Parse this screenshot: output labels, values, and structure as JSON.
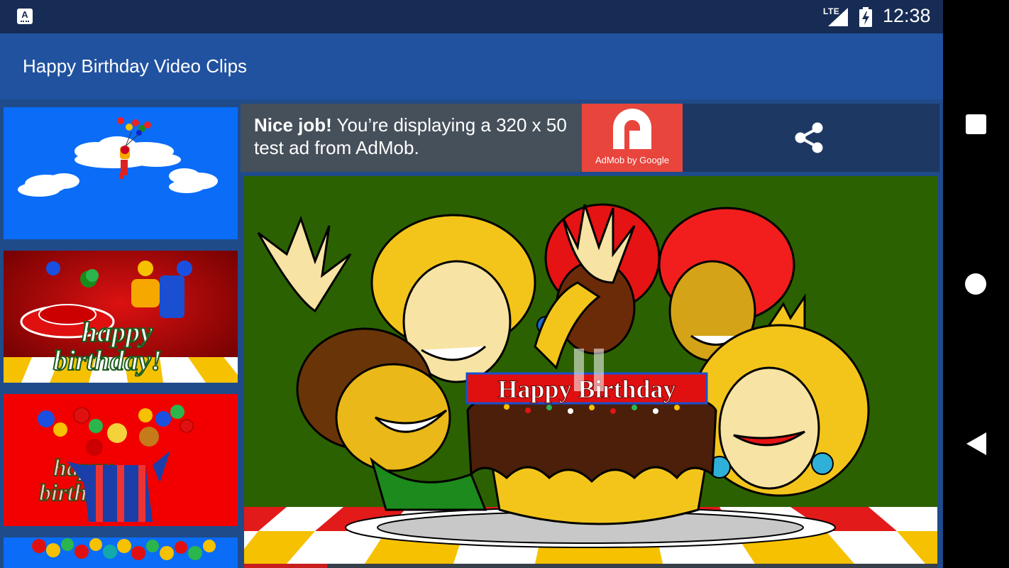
{
  "status_bar": {
    "network": "LTE",
    "time": "12:38",
    "app_icon_letter": "A"
  },
  "app_bar": {
    "title": "Happy Birthday Video Clips"
  },
  "ad": {
    "bold": "Nice job!",
    "text": " You’re displaying a 320 x 50 test ad from AdMob.",
    "brand": "AdMob by Google"
  },
  "video": {
    "cake_banner": "Happy Birthday",
    "progress": 0.12
  },
  "thumbnails": [
    {
      "label": ""
    },
    {
      "label": "happy\nbirthday!"
    },
    {
      "label": ""
    },
    {
      "label": ""
    }
  ],
  "icons": {
    "share": "share-icon",
    "pause": "pause-icon",
    "back": "back-icon",
    "home": "home-icon",
    "recents": "recents-icon"
  },
  "colors": {
    "status_bar": "#172c54",
    "app_bar": "#20529f",
    "content_bg": "#1f4b8a",
    "ad_bg": "#46505a",
    "admob_red": "#e8453c",
    "video_bg": "#2c6101"
  }
}
